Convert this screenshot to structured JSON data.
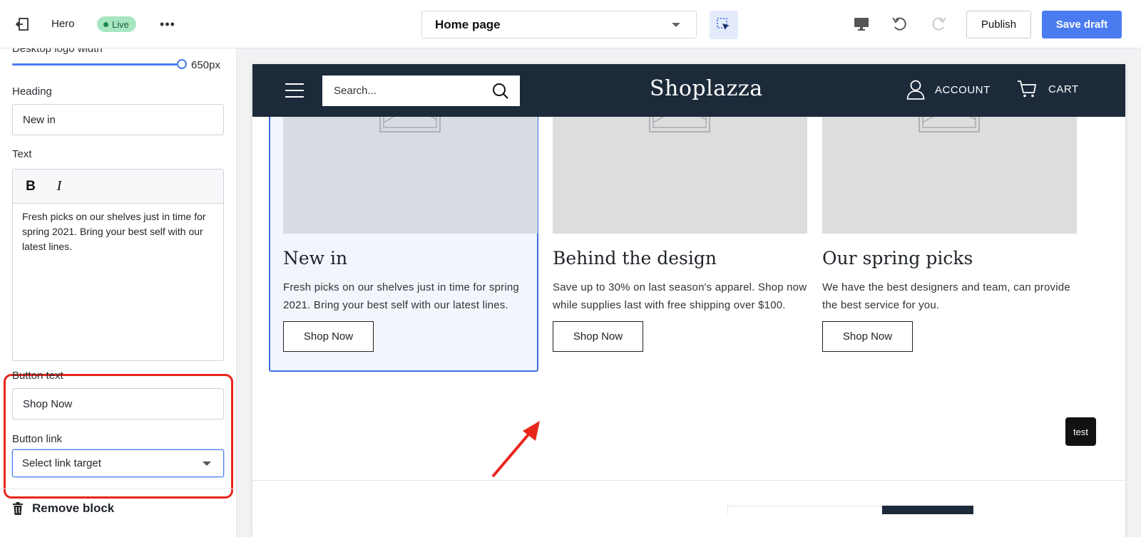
{
  "topbar": {
    "title": "Hero",
    "status_badge": "Live",
    "more_label": "•••",
    "page_select_value": "Home page",
    "publish_label": "Publish",
    "save_label": "Save draft",
    "icons": [
      "exit-icon",
      "more-icon",
      "inspect-icon",
      "desktop-icon",
      "undo-icon",
      "redo-icon"
    ]
  },
  "panel": {
    "logo_width_label": "Desktop logo width",
    "logo_width_value": "650px",
    "heading_label": "Heading",
    "heading_value": "New in",
    "text_label": "Text",
    "text_bold": "B",
    "text_italic": "I",
    "text_value": "Fresh picks on our shelves just in time for spring 2021. Bring your best self with our latest lines.",
    "button_text_label": "Button text",
    "button_text_value": "Shop Now",
    "button_link_label": "Button link",
    "button_link_value": "Select link target",
    "remove_block_label": "Remove block"
  },
  "preview": {
    "search_placeholder": "Search...",
    "logo": "Shoplazza",
    "account_label": "ACCOUNT",
    "cart_label": "CART",
    "cards": [
      {
        "title": "New in",
        "text": "Fresh picks on our shelves just in time for spring 2021. Bring your best self with our latest lines.",
        "button": "Shop Now"
      },
      {
        "title": "Behind the design",
        "text": "Save up to 30% on last season's apparel. Shop now while supplies last with free shipping over $100.",
        "button": "Shop Now"
      },
      {
        "title": "Our spring picks",
        "text": "We have the best designers and team, can provide the best service for you.",
        "button": "Shop Now"
      }
    ],
    "test_badge": "test"
  },
  "colors": {
    "accent": "#4a7cf0",
    "live_badge_bg": "#a8e6c1",
    "store_header": "#1c2a3a",
    "highlight_red": "#e8261c",
    "selection_blue": "#3d6ee0"
  }
}
